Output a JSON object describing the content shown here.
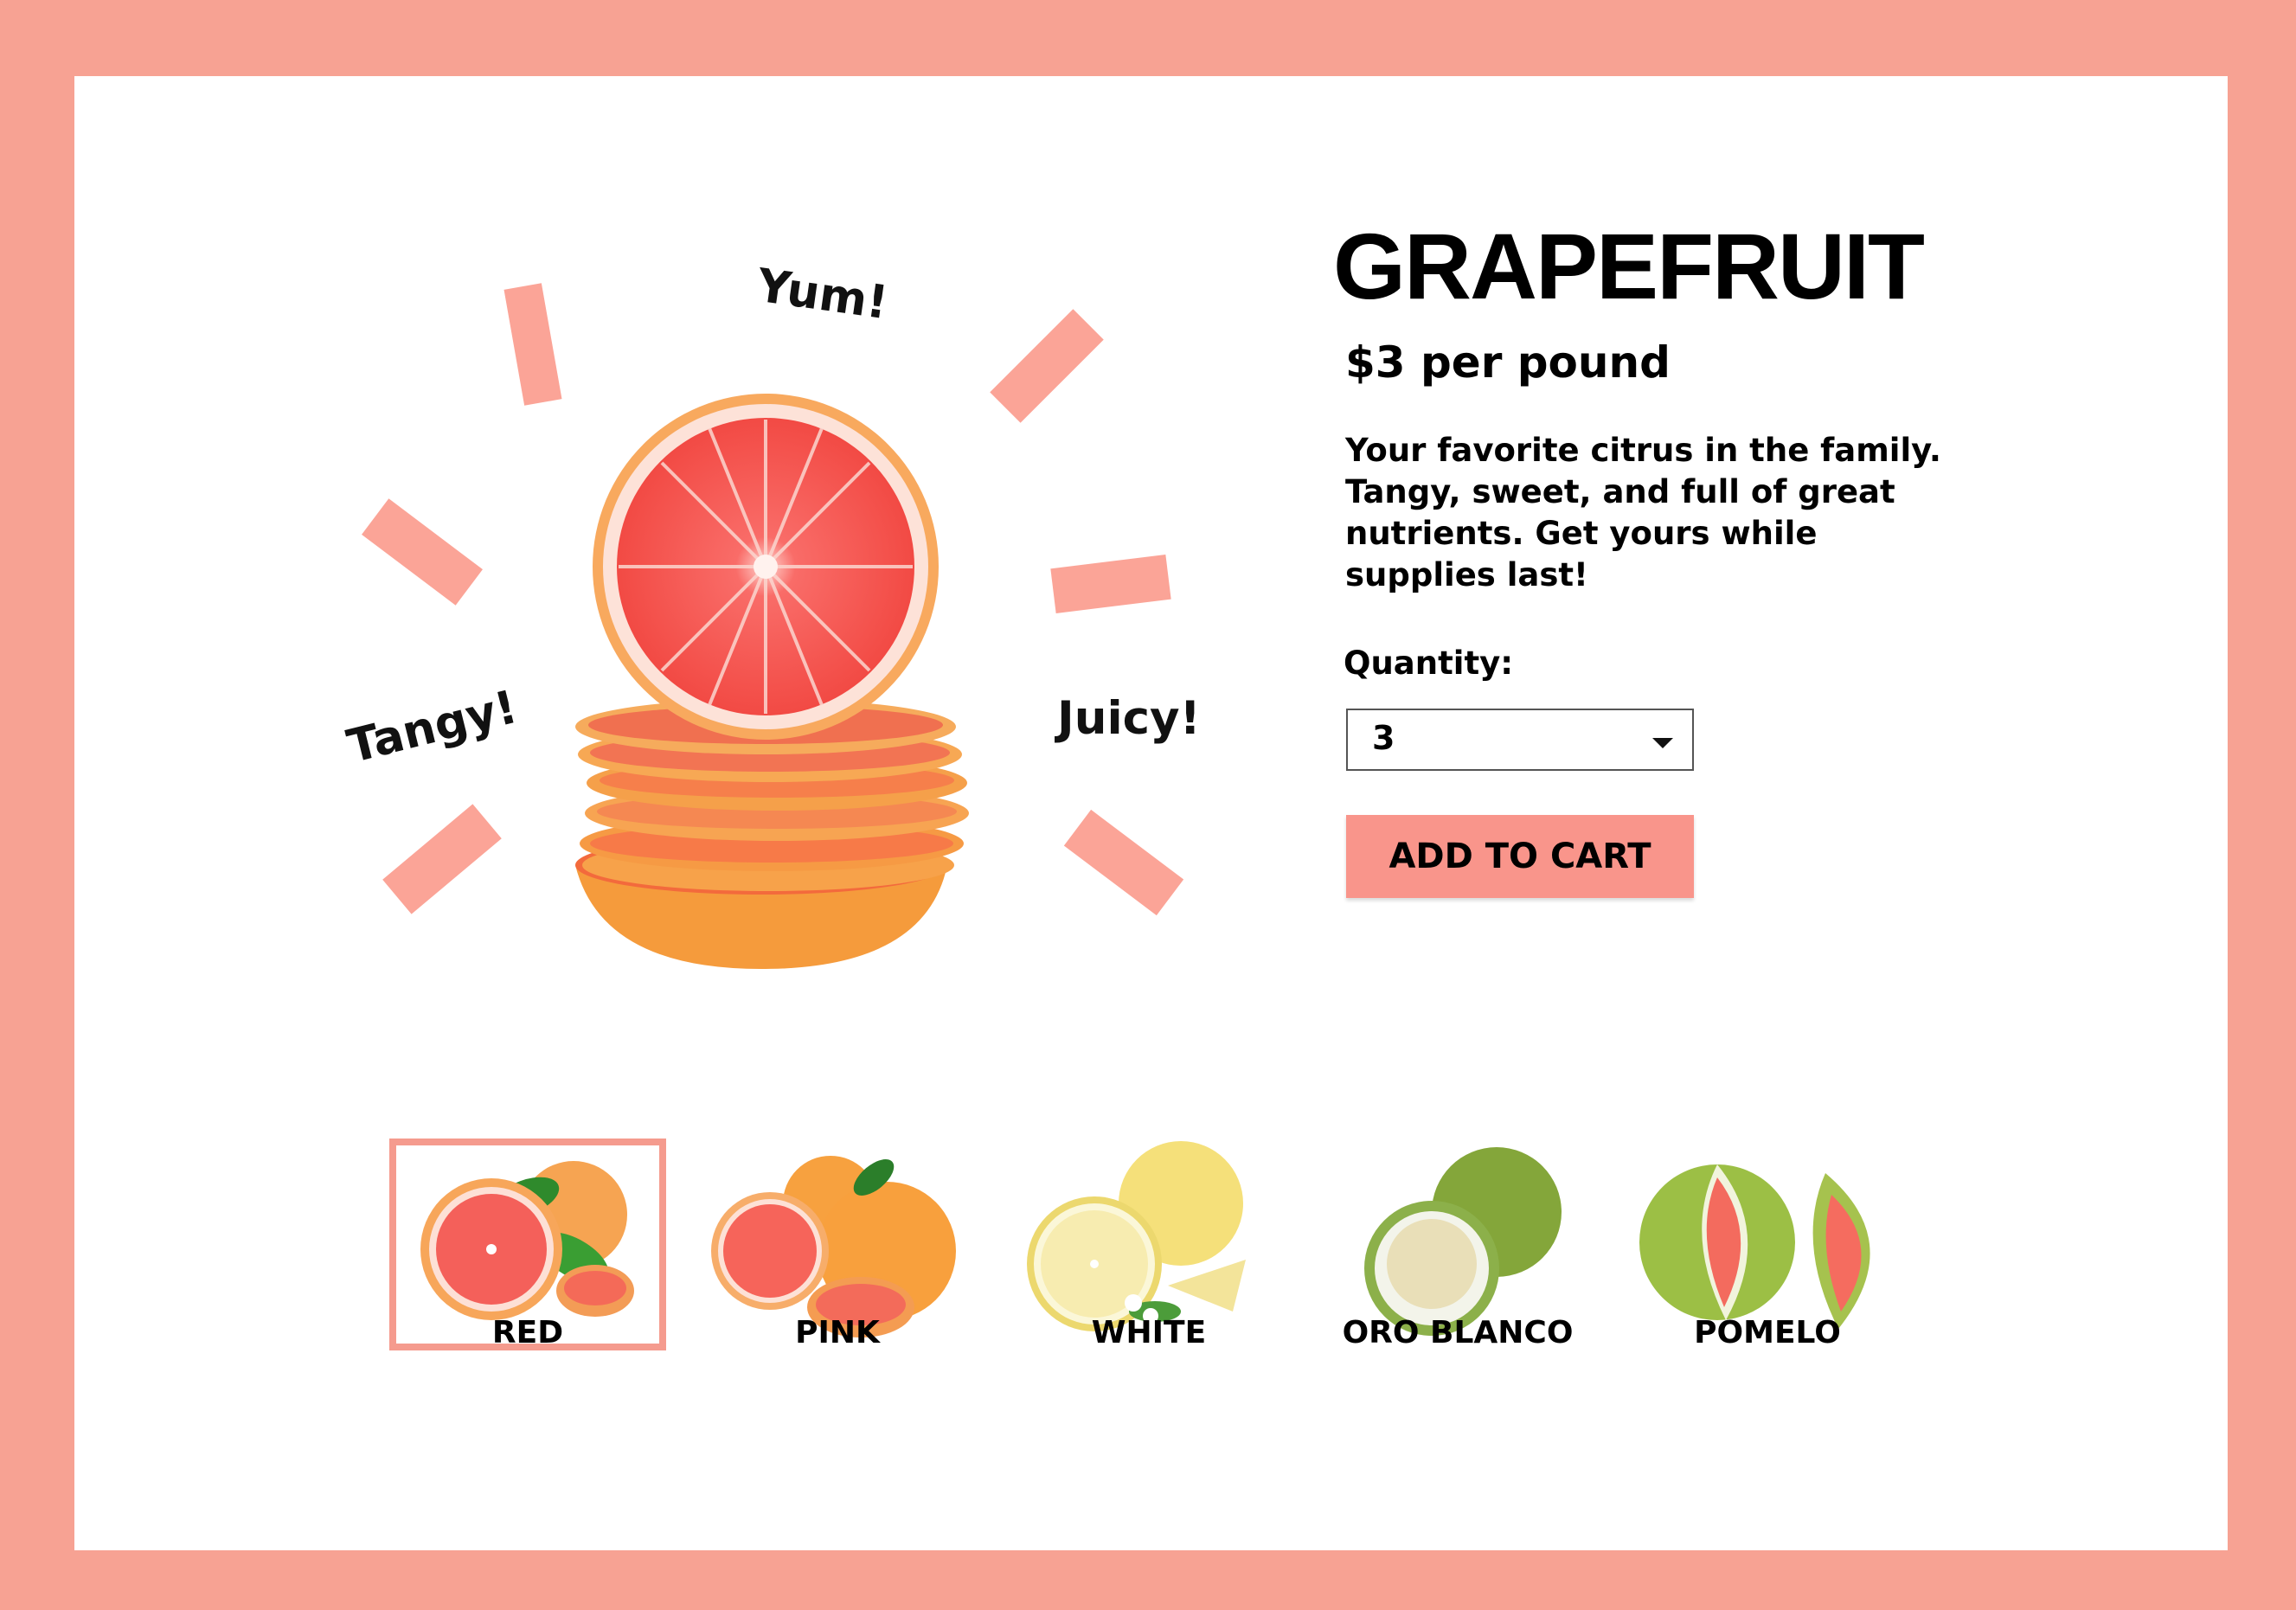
{
  "product": {
    "title": "GRAPEFRUIT",
    "price": "$3 per pound",
    "description": "Your favorite citrus in the family. Tangy, sweet, and full of great nutrients. Get yours while supplies last!",
    "quantity_label": "Quantity:",
    "quantity_value": "3",
    "add_to_cart_label": "ADD TO CART"
  },
  "hero": {
    "exclamations": {
      "top": "Yum!",
      "left": "Tangy!",
      "right": "Juicy!"
    }
  },
  "variants": [
    {
      "label": "RED",
      "selected": true
    },
    {
      "label": "PINK",
      "selected": false
    },
    {
      "label": "WHITE",
      "selected": false
    },
    {
      "label": "ORO BLANCO",
      "selected": false
    },
    {
      "label": "POMELO",
      "selected": false
    }
  ],
  "colors": {
    "frame": "#f7a293",
    "accent": "#f9958b",
    "ray": "#fba497",
    "card": "#ffffff"
  }
}
